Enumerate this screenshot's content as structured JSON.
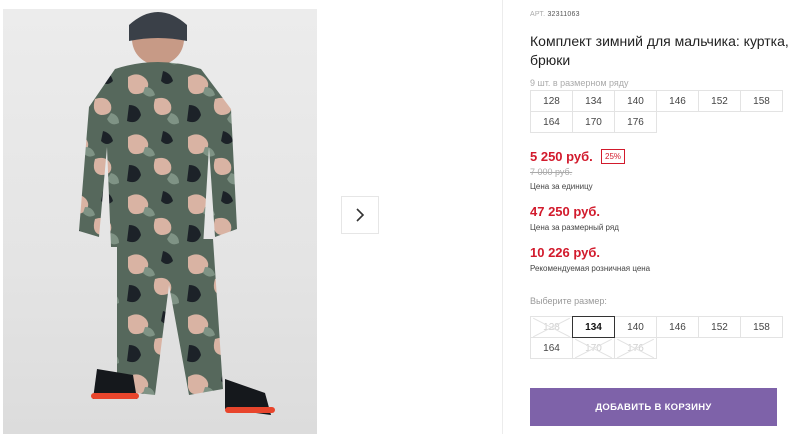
{
  "product": {
    "article_label": "АРТ.",
    "article_number": "32311063",
    "title": "Комплект зимний для мальчика: куртка, брюки",
    "row_note": "9 шт. в размерном ряду",
    "row_sizes": [
      "128",
      "134",
      "140",
      "146",
      "152",
      "158",
      "164",
      "170",
      "176"
    ]
  },
  "prices": {
    "unit_price": "5 250 руб.",
    "discount": "25%",
    "old_price": "7 000 руб.",
    "unit_caption": "Цена за единицу",
    "row_price": "47 250 руб.",
    "row_caption": "Цена за размерный ряд",
    "retail_price": "10 226 руб.",
    "retail_caption": "Рекомендуемая розничная цена"
  },
  "size_select": {
    "label": "Выберите размер:",
    "options": [
      {
        "size": "128",
        "state": "disabled"
      },
      {
        "size": "134",
        "state": "selected"
      },
      {
        "size": "140",
        "state": "available"
      },
      {
        "size": "146",
        "state": "available"
      },
      {
        "size": "152",
        "state": "available"
      },
      {
        "size": "158",
        "state": "available"
      },
      {
        "size": "164",
        "state": "available"
      },
      {
        "size": "170",
        "state": "disabled"
      },
      {
        "size": "176",
        "state": "disabled"
      }
    ]
  },
  "actions": {
    "add_to_cart": "ДОБАВИТЬ В КОРЗИНУ"
  },
  "colors": {
    "price_red": "#d21a2c",
    "button_purple": "#7e62a9"
  },
  "icons": {
    "next": "chevron-right-icon"
  }
}
